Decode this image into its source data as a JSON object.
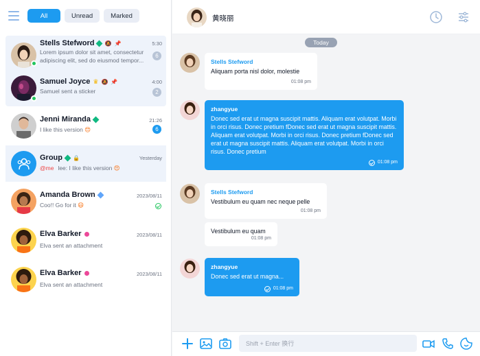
{
  "sidebar": {
    "filters": [
      {
        "label": "All"
      },
      {
        "label": "Unread"
      },
      {
        "label": "Marked"
      }
    ],
    "chats": [
      {
        "name": "Stells Stefword",
        "time": "5:30",
        "msg": "Lorem ipsum dolor sit amet, consectetur adipiscing elit, sed do eiusmod tempor...",
        "badge": "6"
      },
      {
        "name": "Samuel Joyce",
        "time": "4:00",
        "msg": "Samuel sent a sticker",
        "badge": "2"
      },
      {
        "name": "Jenni Miranda",
        "time": "21:26",
        "msg": "I like this version",
        "badge": "6"
      },
      {
        "name": "Group",
        "time": "Yesterday",
        "mention": "@me",
        "msg": "lee: I like this version"
      },
      {
        "name": "Amanda Brown",
        "time": "2023/08/11",
        "msg": "Coo!! Go for it"
      },
      {
        "name": "Elva Barker",
        "time": "2023/08/11",
        "msg": "Elva sent an attachment"
      },
      {
        "name": "Elva Barker",
        "time": "2023/08/11",
        "msg": "Elva sent an attachment"
      }
    ]
  },
  "header": {
    "name": "黄晓丽"
  },
  "messages": {
    "date_label": "Today",
    "items": [
      {
        "sender": "Stells Stefword",
        "text": "Aliquam porta nisl dolor, molestie",
        "time": "01:08 pm"
      },
      {
        "sender": "zhangyue",
        "text": "Donec sed erat ut magna suscipit mattis. Aliquam erat volutpat. Morbi in orci risus. Donec pretium fDonec sed erat ut magna suscipit mattis. Aliquam erat volutpat. Morbi in orci risus. Donec pretium fDonec sed erat ut magna suscipit mattis. Aliquam erat volutpat. Morbi in orci risus. Donec pretium",
        "time": "01:08 pm"
      },
      {
        "sender": "Stells Stefword",
        "text": "Vestibulum eu quam nec neque pelle",
        "time": "01:08 pm"
      },
      {
        "text": "Vestibulum eu quam",
        "time": "01:08 pm"
      },
      {
        "sender": "zhangyue",
        "text": "Donec sed erat ut magna...",
        "time": "01:08 pm"
      }
    ]
  },
  "composer": {
    "placeholder": "Shift + Enter 换行"
  },
  "colors": {
    "accent": "#1d9bf0",
    "online": "#22c55e",
    "mention": "#ef4444"
  }
}
